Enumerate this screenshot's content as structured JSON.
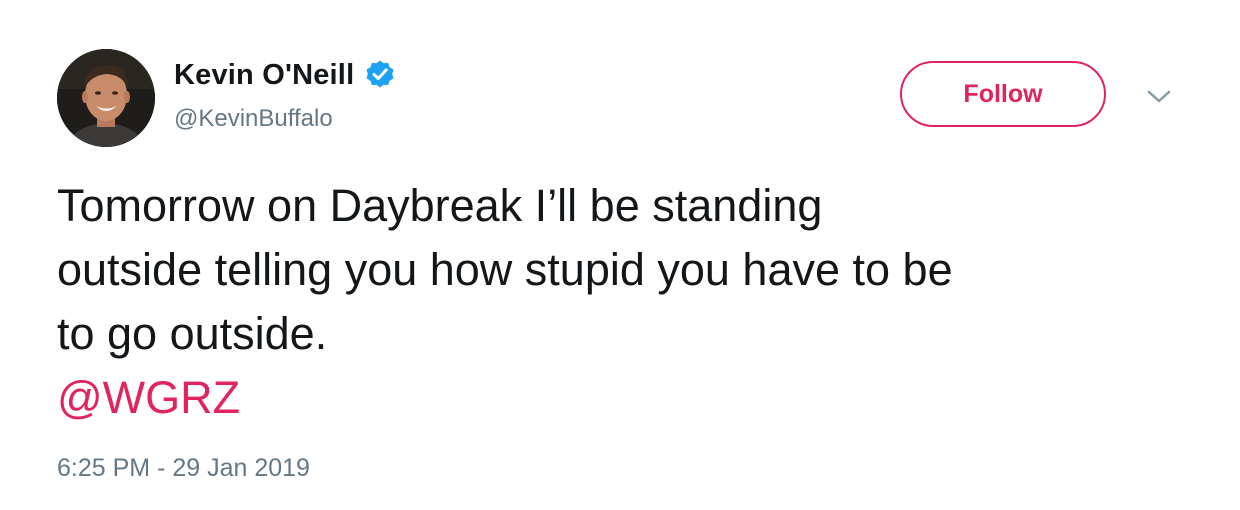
{
  "author": {
    "display_name": "Kevin O'Neill",
    "handle": "@KevinBuffalo",
    "verified": true,
    "verified_icon": "verified-badge-icon",
    "avatar": "profile-photo"
  },
  "actions": {
    "follow_label": "Follow",
    "menu_icon": "chevron-down-icon"
  },
  "tweet": {
    "text_lines": [
      "Tomorrow on Daybreak I’ll be standing",
      "outside telling you how stupid you have to be",
      "to go outside."
    ],
    "mention": "@WGRZ",
    "timestamp": "6:25 PM - 29 Jan 2019"
  },
  "colors": {
    "accent": "#e0245e",
    "verified": "#1da1f2",
    "secondary_text": "#657786",
    "primary_text": "#14171a"
  }
}
